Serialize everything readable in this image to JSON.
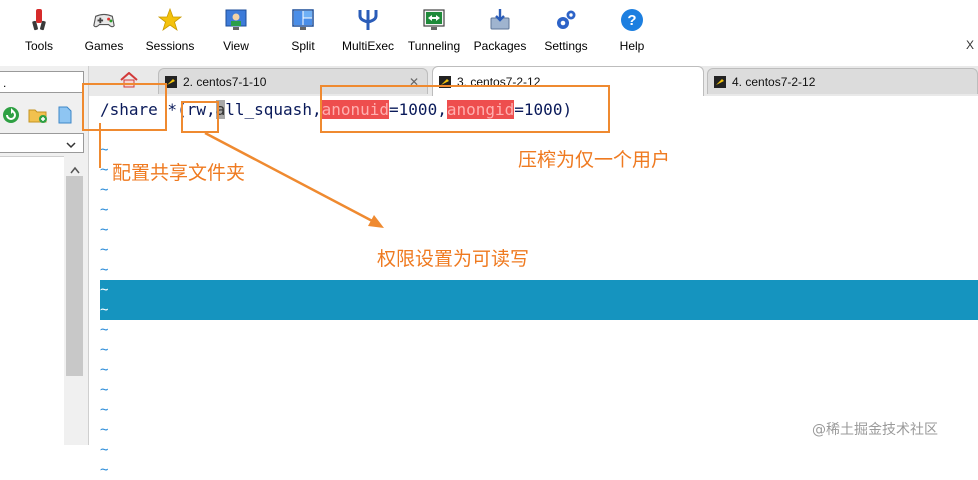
{
  "toolbar": {
    "items": [
      {
        "label": "Tools",
        "icon": "tools-icon"
      },
      {
        "label": "Games",
        "icon": "games-icon"
      },
      {
        "label": "Sessions",
        "icon": "sessions-star-icon"
      },
      {
        "label": "View",
        "icon": "view-icon"
      },
      {
        "label": "Split",
        "icon": "split-icon"
      },
      {
        "label": "MultiExec",
        "icon": "multiexec-icon"
      },
      {
        "label": "Tunneling",
        "icon": "tunneling-icon"
      },
      {
        "label": "Packages",
        "icon": "packages-icon"
      },
      {
        "label": "Settings",
        "icon": "settings-gear-icon"
      },
      {
        "label": "Help",
        "icon": "help-icon"
      }
    ],
    "more_glyph": "X"
  },
  "tabs": [
    {
      "label": "2. centos7-1-10",
      "active": false
    },
    {
      "label": "3. centos7-2-12",
      "active": true
    },
    {
      "label": "4. centos7-2-12",
      "active": false
    }
  ],
  "left_panel": {
    "input_value": "."
  },
  "terminal": {
    "line1": {
      "path": "/share",
      "sp": " *",
      "paren_open": "(",
      "rw": "rw,",
      "all_a": "a",
      "all_rest": "ll_squash",
      "comma1": ",",
      "anonuid": "anonuid",
      "eq1": "=1000",
      "comma2": ",",
      "anongid": "anongid",
      "eq2": "=1000",
      "paren_close": ")"
    },
    "tilde": "~",
    "tilde_count": 17
  },
  "annotations": {
    "config_share": "配置共享文件夹",
    "permission": "权限设置为可读写",
    "squash": "压榨为仅一个用户"
  },
  "colors": {
    "annotation": "#ef8a30",
    "highlight_band": "#1594bf",
    "match_highlight": "#ee4e4e",
    "tilde": "#2b8cd8"
  },
  "watermark": "@稀土掘金技术社区"
}
